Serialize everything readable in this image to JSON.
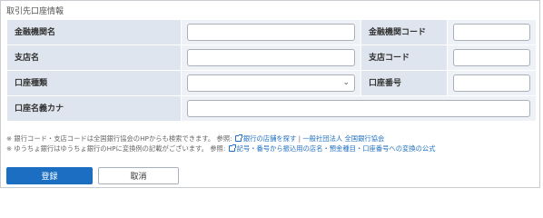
{
  "panel": {
    "title": "取引先口座情報"
  },
  "form": {
    "bank_name_label": "金融機関名",
    "bank_name_value": "",
    "bank_code_label": "金融機関コード",
    "bank_code_value": "",
    "branch_name_label": "支店名",
    "branch_name_value": "",
    "branch_code_label": "支店コード",
    "branch_code_value": "",
    "account_type_label": "口座種類",
    "account_type_selected": "",
    "account_number_label": "口座番号",
    "account_number_value": "",
    "account_holder_label": "口座名義カナ",
    "account_holder_value": ""
  },
  "notes": {
    "line1_text": "※ 銀行コード・支店コードは全国銀行協会のHPからも検索できます。 参照:",
    "line1_link1": "銀行の店舗を探す",
    "line1_sep": " | ",
    "line1_link2": "一般社団法人 全国銀行協会",
    "line2_text": "※ ゆうちょ銀行はゆうちょ銀行のHPに変換例の記載がございます。 参照:",
    "line2_link": "記号・番号から振込用の店名・預金種目・口座番号への変換の公式"
  },
  "buttons": {
    "register": "登録",
    "cancel": "取消"
  },
  "colors": {
    "primary": "#1b6ec2",
    "label_bg": "#dfe5ee",
    "field_bg": "#eef1f6",
    "link": "#1f6fc0"
  },
  "icons": {
    "select_chevron": "chevron-down-icon",
    "external_link": "external-link-icon"
  }
}
